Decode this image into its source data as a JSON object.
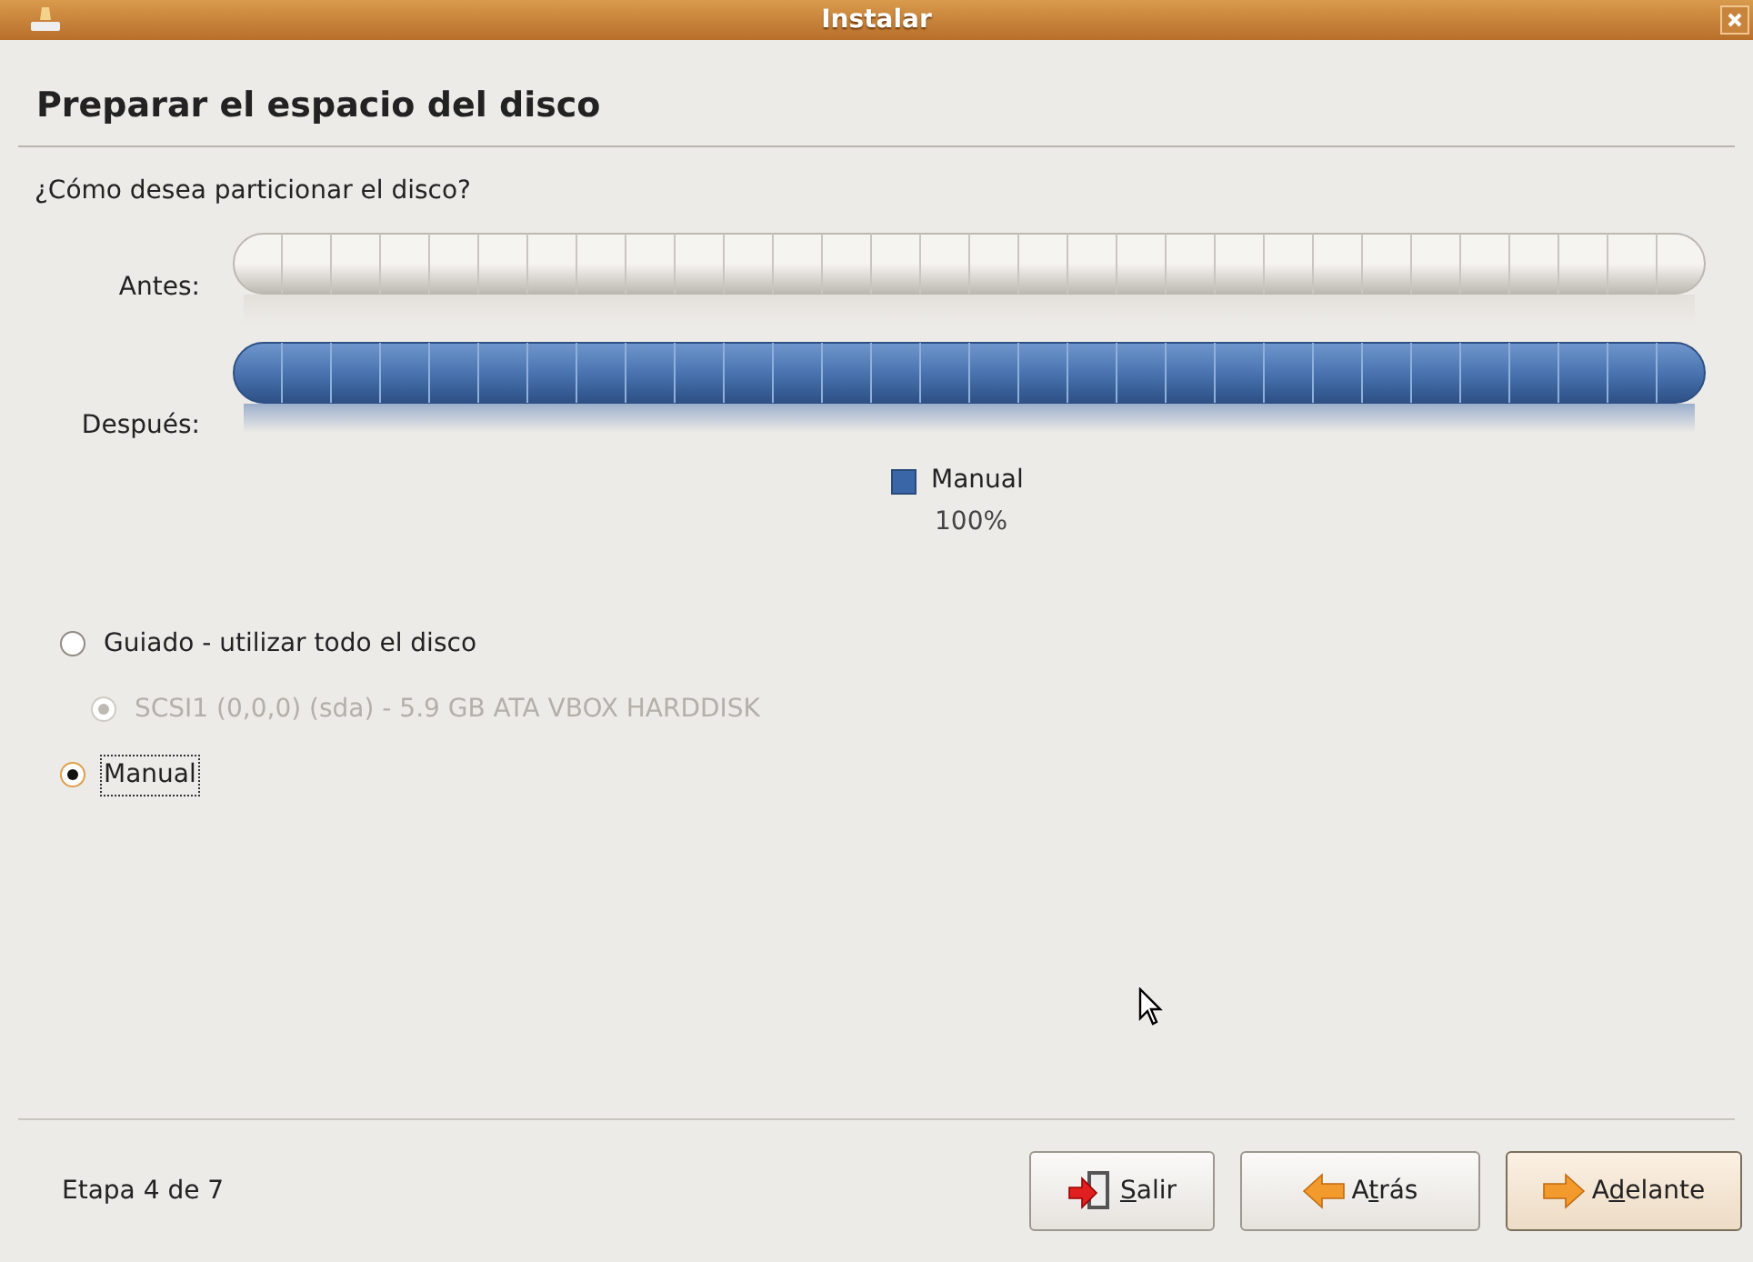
{
  "window": {
    "title": "Instalar"
  },
  "heading": "Preparar el espacio del disco",
  "question": "¿Cómo desea particionar el disco?",
  "bars": [
    {
      "label": "Antes:",
      "kind": "free"
    },
    {
      "label": "Después:",
      "kind": "partition",
      "color": "#4a74b0"
    }
  ],
  "legend": {
    "label": "Manual",
    "percent": "100%",
    "color": "#3a66a8"
  },
  "options": [
    {
      "label": "Guiado - utilizar todo el disco",
      "selected": false,
      "disabled": false,
      "kind": "option"
    },
    {
      "label": "SCSI1 (0,0,0) (sda) - 5.9 GB ATA VBOX HARDDISK",
      "selected": true,
      "disabled": true,
      "kind": "suboption"
    },
    {
      "label": "Manual",
      "selected": true,
      "disabled": false,
      "kind": "option",
      "focused": true
    }
  ],
  "status": "Etapa 4 de 7",
  "buttons": [
    {
      "kind": "quit",
      "key": "S",
      "after": "alir",
      "default": false
    },
    {
      "kind": "back",
      "before": "A",
      "key": "t",
      "after": "rás",
      "default": false
    },
    {
      "kind": "forward",
      "before": "A",
      "key": "d",
      "after": "elante",
      "default": true
    }
  ]
}
